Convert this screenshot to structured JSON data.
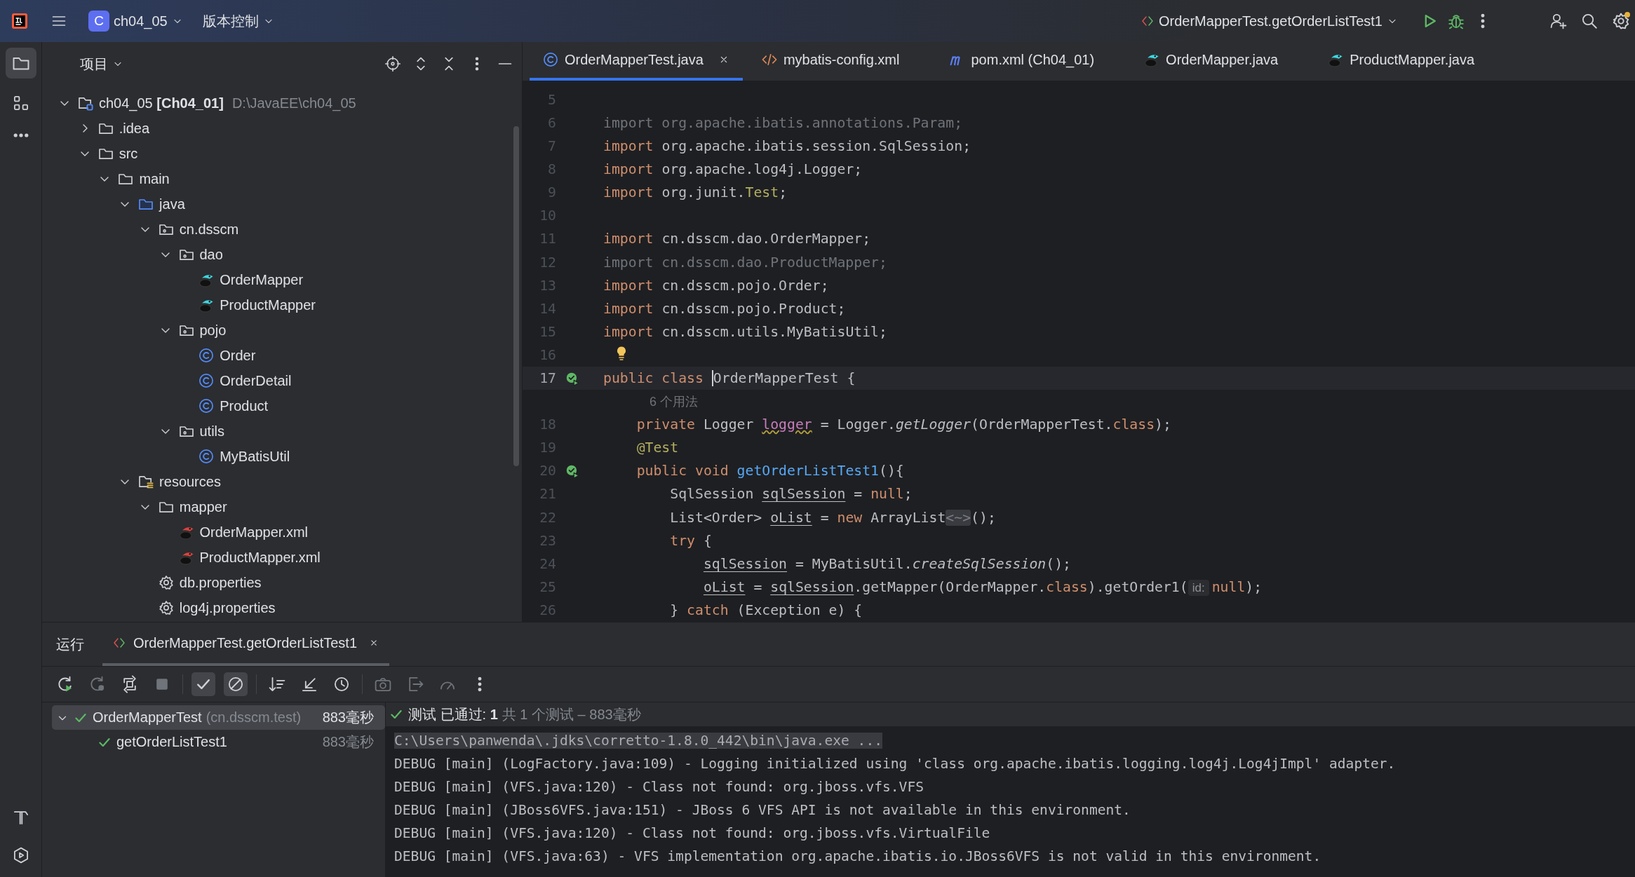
{
  "toolbar": {
    "project_badge": "C",
    "project": "ch04_05",
    "vcs": "版本控制",
    "run_config": "OrderMapperTest.getOrderListTest1"
  },
  "project_panel": {
    "title": "项目",
    "tree": [
      {
        "label": "ch04_05 **[Ch04_01]**",
        "path": "D:\\JavaEE\\ch04_05",
        "kind": "module",
        "expanded": true,
        "children": [
          {
            "label": ".idea",
            "kind": "folder",
            "expanded": false
          },
          {
            "label": "src",
            "kind": "folder",
            "expanded": true,
            "children": [
              {
                "label": "main",
                "kind": "folder",
                "expanded": true,
                "children": [
                  {
                    "label": "java",
                    "kind": "source_root",
                    "expanded": true,
                    "children": [
                      {
                        "label": "cn.dsscm",
                        "kind": "package",
                        "expanded": true,
                        "children": [
                          {
                            "label": "dao",
                            "kind": "package",
                            "expanded": true,
                            "children": [
                              {
                                "label": "OrderMapper",
                                "kind": "mapper"
                              },
                              {
                                "label": "ProductMapper",
                                "kind": "mapper"
                              }
                            ]
                          },
                          {
                            "label": "pojo",
                            "kind": "package",
                            "expanded": true,
                            "children": [
                              {
                                "label": "Order",
                                "kind": "class"
                              },
                              {
                                "label": "OrderDetail",
                                "kind": "class"
                              },
                              {
                                "label": "Product",
                                "kind": "class"
                              }
                            ]
                          },
                          {
                            "label": "utils",
                            "kind": "package",
                            "expanded": true,
                            "children": [
                              {
                                "label": "MyBatisUtil",
                                "kind": "class"
                              }
                            ]
                          }
                        ]
                      }
                    ]
                  },
                  {
                    "label": "resources",
                    "kind": "resource_root",
                    "expanded": true,
                    "children": [
                      {
                        "label": "mapper",
                        "kind": "folder",
                        "expanded": true,
                        "children": [
                          {
                            "label": "OrderMapper.xml",
                            "kind": "mapper_xml"
                          },
                          {
                            "label": "ProductMapper.xml",
                            "kind": "mapper_xml"
                          }
                        ]
                      },
                      {
                        "label": "db.properties",
                        "kind": "properties"
                      },
                      {
                        "label": "log4j.properties",
                        "kind": "properties"
                      }
                    ]
                  }
                ]
              }
            ]
          }
        ]
      }
    ]
  },
  "editor": {
    "tabs": [
      {
        "label": "OrderMapperTest.java",
        "kind": "class",
        "selected": true
      },
      {
        "label": "mybatis-config.xml",
        "kind": "xml",
        "selected": false
      },
      {
        "label": "pom.xml (Ch04_01)",
        "kind": "maven",
        "selected": false
      },
      {
        "label": "OrderMapper.java",
        "kind": "mapper",
        "selected": false
      },
      {
        "label": "ProductMapper.java",
        "kind": "mapper",
        "selected": false
      }
    ],
    "lines": [
      {
        "kind": "code",
        "number": "5",
        "current": false,
        "run_marker": false,
        "bulb": false
      },
      {
        "kind": "code",
        "number": "6",
        "current": false,
        "run_marker": false,
        "bulb": false,
        "tokens": [
          {
            "kind": "dim",
            "text": "import org.apache.ibatis.annotations.Param;"
          }
        ]
      },
      {
        "kind": "code",
        "number": "7",
        "current": false,
        "run_marker": false,
        "bulb": false,
        "tokens": [
          {
            "kind": "kw",
            "text": "import"
          },
          {
            "kind": "plain",
            "text": " org.apache.ibatis.session.SqlSession;"
          }
        ]
      },
      {
        "kind": "code",
        "number": "8",
        "current": false,
        "run_marker": false,
        "bulb": false,
        "tokens": [
          {
            "kind": "kw",
            "text": "import"
          },
          {
            "kind": "plain",
            "text": " org.apache.log4j.Logger;"
          }
        ]
      },
      {
        "kind": "code",
        "number": "9",
        "current": false,
        "run_marker": false,
        "bulb": false,
        "tokens": [
          {
            "kind": "kw",
            "text": "import"
          },
          {
            "kind": "plain",
            "text": " org.junit."
          },
          {
            "kind": "ann",
            "text": "Test"
          },
          {
            "kind": "plain",
            "text": ";"
          }
        ]
      },
      {
        "kind": "code",
        "number": "10",
        "current": false,
        "run_marker": false,
        "bulb": false
      },
      {
        "kind": "code",
        "number": "11",
        "current": false,
        "run_marker": false,
        "bulb": false,
        "tokens": [
          {
            "kind": "kw",
            "text": "import"
          },
          {
            "kind": "plain",
            "text": " cn.dsscm.dao.OrderMapper;"
          }
        ]
      },
      {
        "kind": "code",
        "number": "12",
        "current": false,
        "run_marker": false,
        "bulb": false,
        "tokens": [
          {
            "kind": "dim",
            "text": "import cn.dsscm.dao.ProductMapper;"
          }
        ]
      },
      {
        "kind": "code",
        "number": "13",
        "current": false,
        "run_marker": false,
        "bulb": false,
        "tokens": [
          {
            "kind": "kw",
            "text": "import"
          },
          {
            "kind": "plain",
            "text": " cn.dsscm.pojo.Order;"
          }
        ]
      },
      {
        "kind": "code",
        "number": "14",
        "current": false,
        "run_marker": false,
        "bulb": false,
        "tokens": [
          {
            "kind": "kw",
            "text": "import"
          },
          {
            "kind": "plain",
            "text": " cn.dsscm.pojo.Product;"
          }
        ]
      },
      {
        "kind": "code",
        "number": "15",
        "current": false,
        "run_marker": false,
        "bulb": false,
        "tokens": [
          {
            "kind": "kw",
            "text": "import"
          },
          {
            "kind": "plain",
            "text": " cn.dsscm.utils.MyBatisUtil;"
          }
        ]
      },
      {
        "kind": "code",
        "number": "16",
        "current": false,
        "run_marker": false,
        "bulb": true
      },
      {
        "kind": "code",
        "number": "17",
        "current": true,
        "run_marker": true,
        "bulb": false,
        "tokens": [
          {
            "kind": "kw",
            "text": "public class "
          },
          {
            "kind": "caret",
            "text": "OrderMapperTest"
          },
          {
            "kind": "plain",
            "text": " {"
          }
        ]
      },
      {
        "kind": "hint",
        "text": "6 个用法"
      },
      {
        "kind": "code",
        "number": "18",
        "current": false,
        "run_marker": false,
        "bulb": false,
        "tokens": [
          {
            "kind": "kw",
            "text": "    private "
          },
          {
            "kind": "plain",
            "text": "Logger "
          },
          {
            "kind": "field_warn",
            "text": "logger"
          },
          {
            "kind": "plain",
            "text": " = Logger."
          },
          {
            "kind": "italic",
            "text": "getLogger"
          },
          {
            "kind": "plain",
            "text": "(OrderMapperTest."
          },
          {
            "kind": "kw",
            "text": "class"
          },
          {
            "kind": "plain",
            "text": ");"
          }
        ]
      },
      {
        "kind": "code",
        "number": "19",
        "current": false,
        "run_marker": false,
        "bulb": false,
        "tokens": [
          {
            "kind": "ann",
            "text": "    @Test"
          }
        ]
      },
      {
        "kind": "code",
        "number": "20",
        "current": false,
        "run_marker": true,
        "bulb": false,
        "tokens": [
          {
            "kind": "kw",
            "text": "    public void "
          },
          {
            "kind": "decl",
            "text": "getOrderListTest1"
          },
          {
            "kind": "plain",
            "text": "(){"
          }
        ]
      },
      {
        "kind": "code",
        "number": "21",
        "current": false,
        "run_marker": false,
        "bulb": false,
        "tokens": [
          {
            "kind": "plain",
            "text": "        SqlSession "
          },
          {
            "kind": "reassigned",
            "text": "sqlSession"
          },
          {
            "kind": "plain",
            "text": " = "
          },
          {
            "kind": "kw",
            "text": "null"
          },
          {
            "kind": "plain",
            "text": ";"
          }
        ]
      },
      {
        "kind": "code",
        "number": "22",
        "current": false,
        "run_marker": false,
        "bulb": false,
        "tokens": [
          {
            "kind": "plain",
            "text": "        List<Order> "
          },
          {
            "kind": "reassigned",
            "text": "oList"
          },
          {
            "kind": "plain",
            "text": " = "
          },
          {
            "kind": "kw",
            "text": "new "
          },
          {
            "kind": "plain",
            "text": "ArrayList"
          },
          {
            "kind": "fold",
            "text": "<~>"
          },
          {
            "kind": "plain",
            "text": "();"
          }
        ]
      },
      {
        "kind": "code",
        "number": "23",
        "current": false,
        "run_marker": false,
        "bulb": false,
        "tokens": [
          {
            "kind": "kw",
            "text": "        try "
          },
          {
            "kind": "plain",
            "text": "{"
          }
        ]
      },
      {
        "kind": "code",
        "number": "24",
        "current": false,
        "run_marker": false,
        "bulb": false,
        "tokens": [
          {
            "kind": "reassigned",
            "text": "            sqlSession"
          },
          {
            "kind": "plain",
            "text": " = MyBatisUtil."
          },
          {
            "kind": "italic",
            "text": "createSqlSession"
          },
          {
            "kind": "plain",
            "text": "();"
          }
        ]
      },
      {
        "kind": "code",
        "number": "25",
        "current": false,
        "run_marker": false,
        "bulb": false,
        "tokens": [
          {
            "kind": "reassigned",
            "text": "            oList"
          },
          {
            "kind": "plain",
            "text": " = "
          },
          {
            "kind": "reassigned",
            "text": "sqlSession"
          },
          {
            "kind": "plain",
            "text": ".getMapper(OrderMapper."
          },
          {
            "kind": "kw",
            "text": "class"
          },
          {
            "kind": "plain",
            "text": ").getOrder1("
          },
          {
            "kind": "inlay",
            "text": "id:"
          },
          {
            "kind": "kw",
            "text": "null"
          },
          {
            "kind": "plain",
            "text": ");"
          }
        ]
      },
      {
        "kind": "code",
        "number": "26",
        "current": false,
        "run_marker": false,
        "bulb": false,
        "tokens": [
          {
            "kind": "plain",
            "text": "        } "
          },
          {
            "kind": "kw",
            "text": "catch "
          },
          {
            "kind": "plain",
            "text": "(Exception e) {"
          }
        ]
      }
    ]
  },
  "run_panel": {
    "title": "运行",
    "tab": "OrderMapperTest.getOrderListTest1",
    "results": [
      {
        "label": "OrderMapperTest",
        "package": "(cn.dsscm.test)",
        "time": "883毫秒",
        "selected": true,
        "expanded": true,
        "children": [
          {
            "label": "getOrderListTest1",
            "time": "883毫秒",
            "selected": false
          }
        ]
      }
    ],
    "status": "测试 已通过: **1**",
    "summary": "共 1 个测试 – 883毫秒",
    "console": [
      {
        "kind": "command",
        "text": "C:\\Users\\panwenda\\.jdks\\corretto-1.8.0_442\\bin\\java.exe ..."
      },
      {
        "kind": "log",
        "text": "DEBUG [main] (LogFactory.java:109) - Logging initialized using 'class org.apache.ibatis.logging.log4j.Log4jImpl' adapter."
      },
      {
        "kind": "log",
        "text": "DEBUG [main] (VFS.java:120) - Class not found: org.jboss.vfs.VFS"
      },
      {
        "kind": "log",
        "text": "DEBUG [main] (JBoss6VFS.java:151) - JBoss 6 VFS API is not available in this environment."
      },
      {
        "kind": "log",
        "text": "DEBUG [main] (VFS.java:120) - Class not found: org.jboss.vfs.VirtualFile"
      },
      {
        "kind": "log",
        "text": "DEBUG [main] (VFS.java:63) - VFS implementation org.apache.ibatis.io.JBoss6VFS is not valid in this environment."
      }
    ]
  }
}
